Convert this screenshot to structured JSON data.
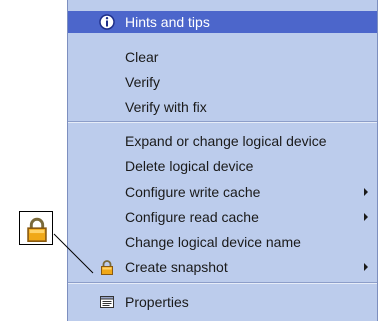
{
  "menu": {
    "items": [
      {
        "label": "Hints and tips",
        "icon": "info-icon",
        "highlighted": true
      },
      {
        "label": "Clear"
      },
      {
        "label": "Verify"
      },
      {
        "label": "Verify with fix"
      },
      {
        "label": "Expand or change logical device"
      },
      {
        "label": "Delete logical device"
      },
      {
        "label": "Configure write cache",
        "submenu": true
      },
      {
        "label": "Configure read cache",
        "submenu": true
      },
      {
        "label": "Change logical device name"
      },
      {
        "label": "Create snapshot",
        "icon": "padlock-icon",
        "submenu": true
      },
      {
        "label": "Properties",
        "icon": "properties-icon"
      }
    ]
  },
  "callout": {
    "icon": "padlock-icon"
  },
  "colors": {
    "menu_bg": "#bcccec",
    "highlight": "#4c66cb",
    "text": "#1a1a1a"
  }
}
